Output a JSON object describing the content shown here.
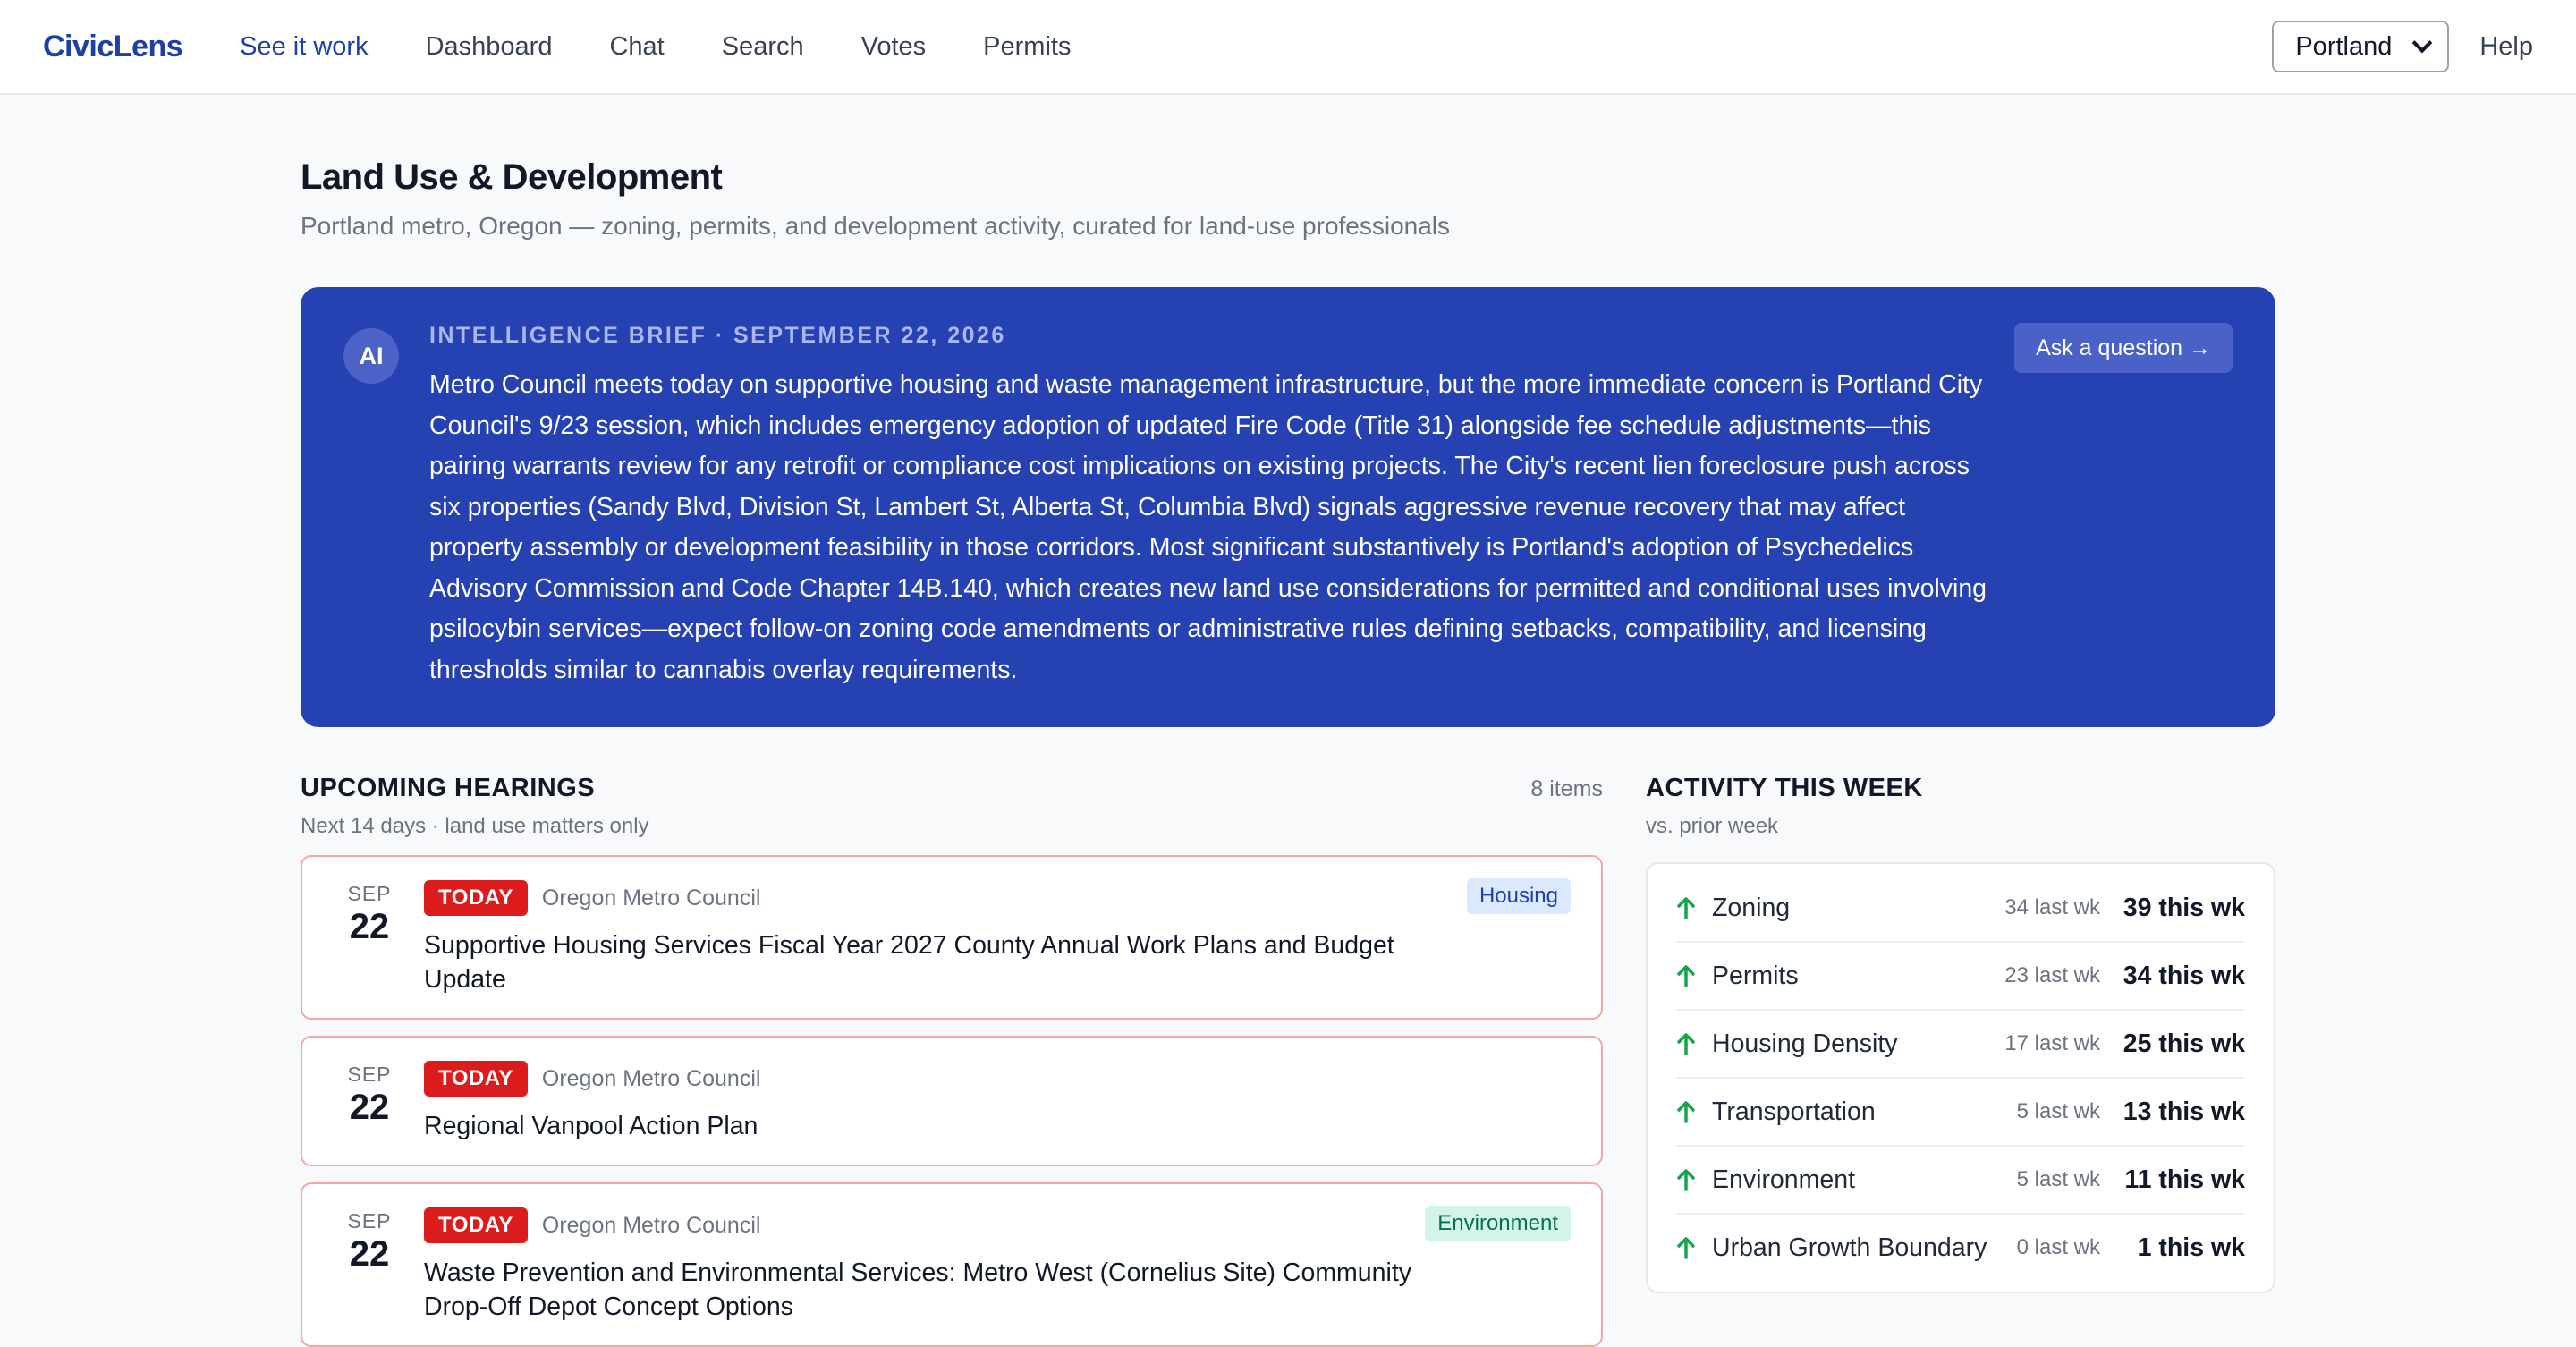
{
  "nav": {
    "brand": "CivicLens",
    "links": [
      "See it work",
      "Dashboard",
      "Chat",
      "Search",
      "Votes",
      "Permits"
    ],
    "city": "Portland",
    "help": "Help"
  },
  "page": {
    "title": "Land Use & Development",
    "subtitle": "Portland metro, Oregon — zoning, permits, and development activity, curated for land-use professionals"
  },
  "brief": {
    "badge": "AI",
    "label": "INTELLIGENCE BRIEF · SEPTEMBER 22, 2026",
    "text": "Metro Council meets today on supportive housing and waste management infrastructure, but the more immediate concern is Portland City Council's 9/23 session, which includes emergency adoption of updated Fire Code (Title 31) alongside fee schedule adjustments—this pairing warrants review for any retrofit or compliance cost implications on existing projects. The City's recent lien foreclosure push across six properties (Sandy Blvd, Division St, Lambert St, Alberta St, Columbia Blvd) signals aggressive revenue recovery that may affect property assembly or development feasibility in those corridors. Most significant substantively is Portland's adoption of Psychedelics Advisory Commission and Code Chapter 14B.140, which creates new land use considerations for permitted and conditional uses involving psilocybin services—expect follow-on zoning code amendments or administrative rules defining setbacks, compatibility, and licensing thresholds similar to cannabis overlay requirements.",
    "ask_button": "Ask a question →"
  },
  "hearings": {
    "title": "UPCOMING HEARINGS",
    "count": "8 items",
    "subtitle": "Next 14 days · land use matters only",
    "items": [
      {
        "month": "SEP",
        "day": "22",
        "badge": "TODAY",
        "body": "Oregon Metro Council",
        "tag": "Housing",
        "title": "Supportive Housing Services Fiscal Year 2027 County Annual Work Plans and Budget Update"
      },
      {
        "month": "SEP",
        "day": "22",
        "badge": "TODAY",
        "body": "Oregon Metro Council",
        "tag": "",
        "title": "Regional Vanpool Action Plan"
      },
      {
        "month": "SEP",
        "day": "22",
        "badge": "TODAY",
        "body": "Oregon Metro Council",
        "tag": "Environment",
        "title": "Waste Prevention and Environmental Services: Metro West (Cornelius Site) Community Drop-Off Depot Concept Options"
      }
    ]
  },
  "activity": {
    "title": "ACTIVITY THIS WEEK",
    "subtitle": "vs. prior week",
    "rows": [
      {
        "name": "Zoning",
        "last": "34 last wk",
        "this": "39 this wk"
      },
      {
        "name": "Permits",
        "last": "23 last wk",
        "this": "34 this wk"
      },
      {
        "name": "Housing Density",
        "last": "17 last wk",
        "this": "25 this wk"
      },
      {
        "name": "Transportation",
        "last": "5 last wk",
        "this": "13 this wk"
      },
      {
        "name": "Environment",
        "last": "5 last wk",
        "this": "11 this wk"
      },
      {
        "name": "Urban Growth Boundary",
        "last": "0 last wk",
        "this": "1 this wk"
      }
    ]
  },
  "colors": {
    "brand": "#1e3fa8",
    "brief_bg": "#2541b2",
    "today": "#dc1c1c",
    "trend_up": "#16a34a"
  }
}
